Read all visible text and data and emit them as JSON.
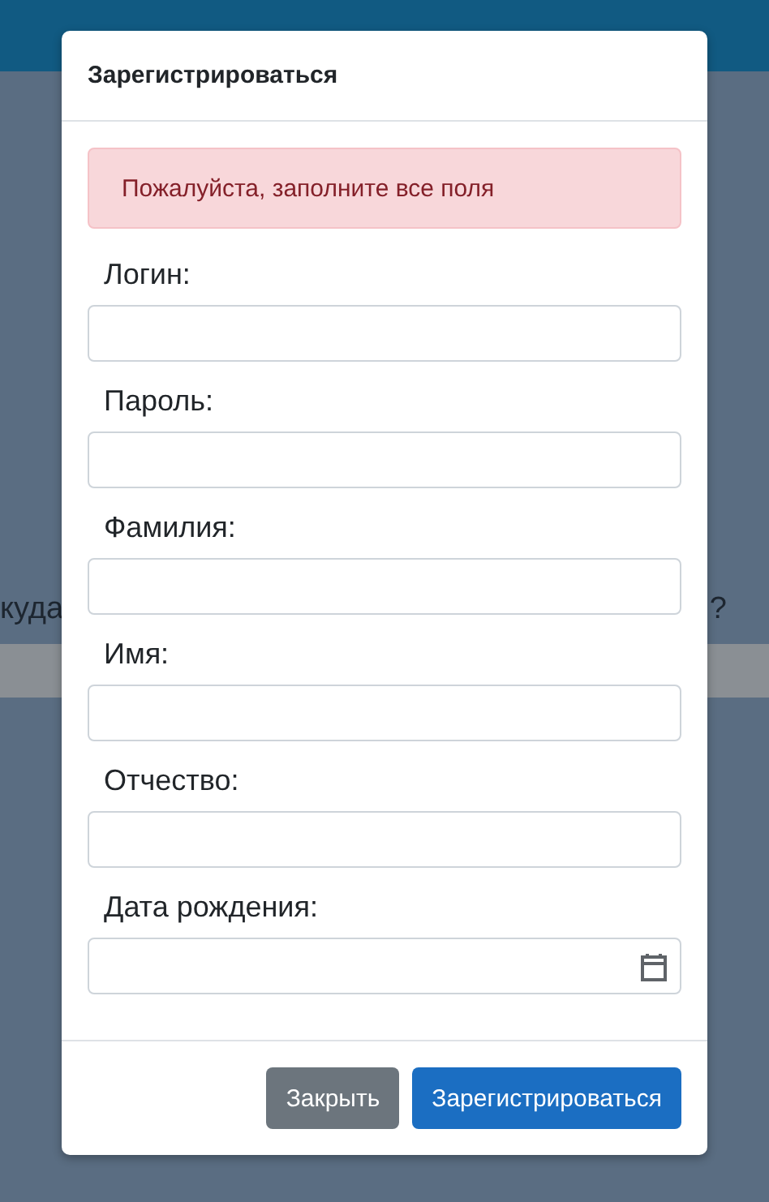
{
  "backdrop": {
    "text_left": "куда",
    "text_right": "?"
  },
  "modal": {
    "title": "Зарегистрироваться",
    "alert": "Пожалуйста, заполните все поля",
    "fields": [
      {
        "label": "Логин:",
        "kind": "text"
      },
      {
        "label": "Пароль:",
        "kind": "password"
      },
      {
        "label": "Фамилия:",
        "kind": "text"
      },
      {
        "label": "Имя:",
        "kind": "text"
      },
      {
        "label": "Отчество:",
        "kind": "text"
      },
      {
        "label": "Дата рождения:",
        "kind": "date"
      }
    ],
    "buttons": [
      {
        "label": "Закрыть",
        "kind": "secondary"
      },
      {
        "label": "Зарегистрироваться",
        "kind": "primary"
      }
    ]
  }
}
